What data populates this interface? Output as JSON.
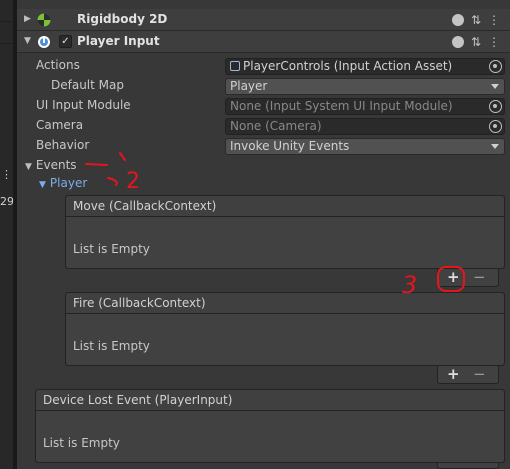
{
  "left_panel": {
    "dots": "⋮",
    "number": "29"
  },
  "components": [
    {
      "title": "Rigidbody 2D",
      "icon": "rigidbody-physics-icon"
    },
    {
      "title": "Player Input",
      "icon": "player-input-icon",
      "enabled": true,
      "enabled_glyph": "✓"
    }
  ],
  "header_icons": {
    "help": "?",
    "settings": "⇅",
    "menu": "⋮"
  },
  "properties": {
    "actions": {
      "label": "Actions",
      "value": "PlayerControls (Input Action Asset)"
    },
    "default_map": {
      "label": "Default Map",
      "value": "Player"
    },
    "ui_input_module": {
      "label": "UI Input Module",
      "value": "None (Input System UI Input Module)"
    },
    "camera": {
      "label": "Camera",
      "value": "None (Camera)"
    },
    "behavior": {
      "label": "Behavior",
      "value": "Invoke Unity Events"
    }
  },
  "events": {
    "label": "Events",
    "player_label": "Player",
    "items": [
      {
        "title": "Move (CallbackContext)",
        "body": "List is Empty"
      },
      {
        "title": "Fire (CallbackContext)",
        "body": "List is Empty"
      },
      {
        "title": "Device Lost Event (PlayerInput)",
        "body": "List is Empty"
      }
    ]
  },
  "footer": {
    "add": "+",
    "remove": "−"
  },
  "annotations": {
    "mark_2": "2",
    "mark_3": "3",
    "color": "#e8141b"
  },
  "colors": {
    "accent_blue": "#7aaeea",
    "annotation_red": "#e8141b"
  }
}
